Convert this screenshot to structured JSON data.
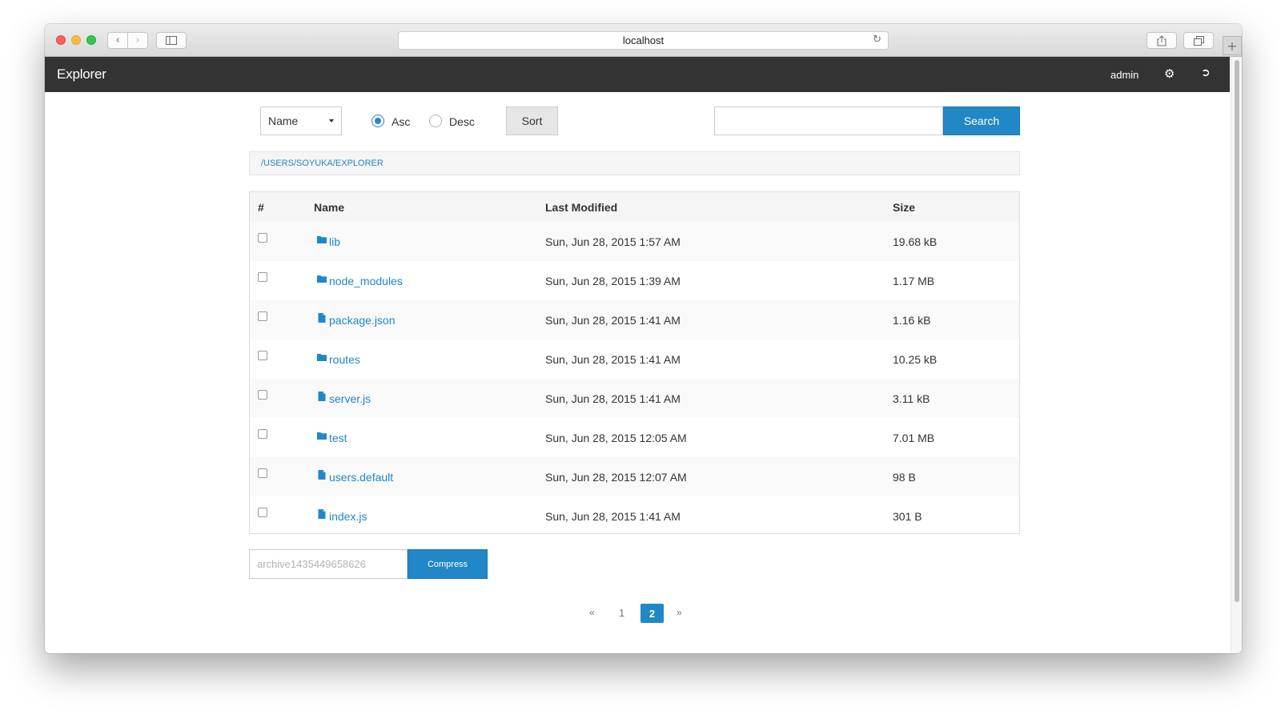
{
  "browser": {
    "url": "localhost"
  },
  "navbar": {
    "brand": "Explorer",
    "user": "admin"
  },
  "toolbar": {
    "sort_field": "Name",
    "asc_label": "Asc",
    "desc_label": "Desc",
    "order_selected": "Asc",
    "sort_label": "Sort",
    "search_value": "",
    "search_label": "Search"
  },
  "breadcrumb": "/USERS/SOYUKA/EXPLORER",
  "table": {
    "headers": {
      "hash": "#",
      "name": "Name",
      "modified": "Last Modified",
      "size": "Size"
    },
    "rows": [
      {
        "type": "folder",
        "name": "lib",
        "modified": "Sun, Jun 28, 2015 1:57 AM",
        "size": "19.68 kB"
      },
      {
        "type": "folder",
        "name": "node_modules",
        "modified": "Sun, Jun 28, 2015 1:39 AM",
        "size": "1.17 MB"
      },
      {
        "type": "file",
        "name": "package.json",
        "modified": "Sun, Jun 28, 2015 1:41 AM",
        "size": "1.16 kB"
      },
      {
        "type": "folder",
        "name": "routes",
        "modified": "Sun, Jun 28, 2015 1:41 AM",
        "size": "10.25 kB"
      },
      {
        "type": "file",
        "name": "server.js",
        "modified": "Sun, Jun 28, 2015 1:41 AM",
        "size": "3.11 kB"
      },
      {
        "type": "folder",
        "name": "test",
        "modified": "Sun, Jun 28, 2015 12:05 AM",
        "size": "7.01 MB"
      },
      {
        "type": "file",
        "name": "users.default",
        "modified": "Sun, Jun 28, 2015 12:07 AM",
        "size": "98 B"
      },
      {
        "type": "file",
        "name": "index.js",
        "modified": "Sun, Jun 28, 2015 1:41 AM",
        "size": "301 B"
      }
    ]
  },
  "archive": {
    "placeholder": "archive1435449658626",
    "compress_label": "Compress"
  },
  "pagination": {
    "prev": "«",
    "pages": [
      "1",
      "2"
    ],
    "current": "2",
    "next": "»"
  },
  "colors": {
    "accent": "#2187c6",
    "navbar": "#333333"
  }
}
